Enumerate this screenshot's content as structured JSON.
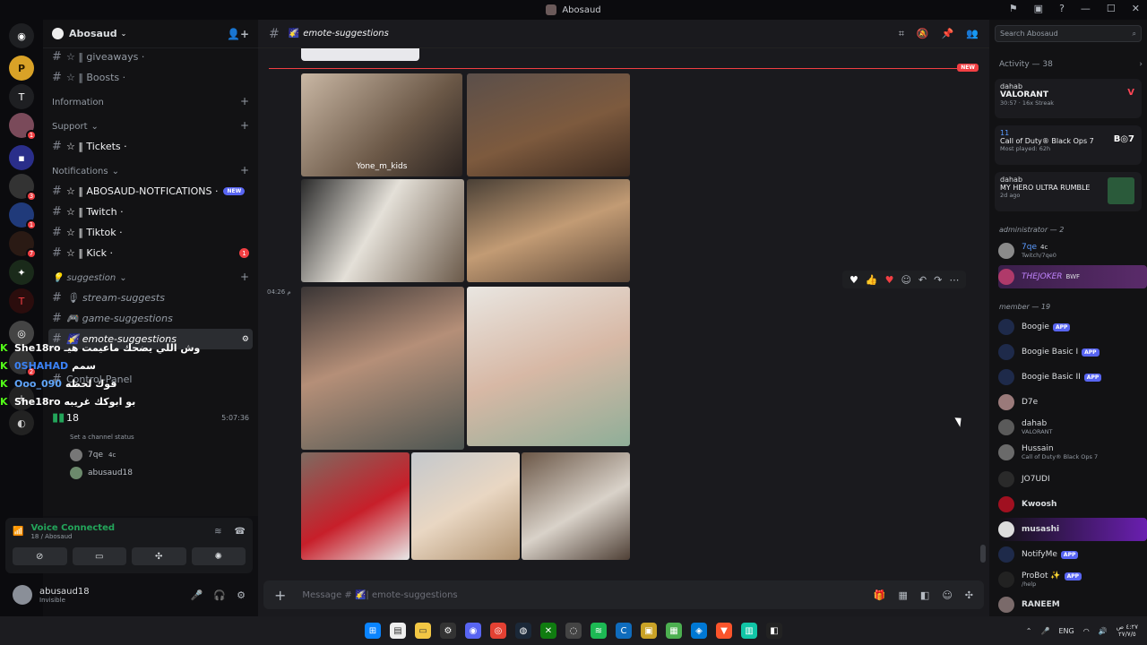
{
  "window": {
    "title": "Abosaud"
  },
  "guild": {
    "name": "Abosaud"
  },
  "channels": [
    {
      "label": "☆ ‖ giveaways ·",
      "y": 0
    },
    {
      "label": "☆ ‖ Boosts ·"
    }
  ],
  "categories": {
    "information": "Information",
    "support": "Support",
    "notifications": "Notifications",
    "suggestion": "suggestion"
  },
  "ch": {
    "giveaways": "☆ ‖ giveaways ·",
    "boosts": "☆ ‖ Boosts ·",
    "tickets": "☆ ‖ Tickets ·",
    "abosaud_notif": "☆ ‖ ABOSAUD-NOTFICATIONS ·",
    "new": "NEW",
    "twitch": "☆ ‖ Twitch ·",
    "tiktok": "☆ ‖ Tiktok ·",
    "kick": "☆ ‖ Kick ·",
    "kick_mentions": "1",
    "stream": "stream-suggests",
    "game": "game-suggestions",
    "emote": "emote-suggestions",
    "control": "Control-Panel",
    "voice": "18",
    "voice_time": "5:07:36",
    "voice_status": "Set a channel status",
    "voice_user1": "7qe",
    "voice_user1_tag": "4c",
    "voice_user2": "abusaud18"
  },
  "chat_overlay": [
    {
      "name": "She18ro",
      "text": "وش اللي يضحك ماعيمت هيـ"
    },
    {
      "name": "0SHAHAD",
      "text": "سمم"
    },
    {
      "name": "Ooo_090",
      "text": "فوك لحظه"
    },
    {
      "name": "She18ro",
      "text": "بو ابوكك غريبه"
    }
  ],
  "voice_panel": {
    "status": "Voice Connected",
    "channel": "18 / Abosaud"
  },
  "user": {
    "name": "abusaud18",
    "status": "Invisible"
  },
  "main": {
    "channel": "emote-suggestions",
    "new_label": "NEW",
    "timestamp": "04:26 م",
    "watermark": "Yone_m_kids",
    "composer_placeholder": "Message # 🌠| emote-suggestions"
  },
  "members_panel": {
    "search_placeholder": "Search Abosaud",
    "activity_header": "Activity — 38",
    "activities": [
      {
        "user": "dahab",
        "game": "VALORANT",
        "meta": "30:57 · 16x Streak"
      },
      {
        "user": "11",
        "game": "Call of Duty® Black Ops 7",
        "meta": "Most played: 62h"
      },
      {
        "user": "dahab",
        "game": "MY HERO ULTRA RUMBLE",
        "meta": "2d ago"
      }
    ],
    "admin_header": "administrator — 2",
    "admins": [
      {
        "name": "7qe",
        "tag": "4c",
        "sub": "Twitch/7qe0"
      },
      {
        "name": "THEJOKER",
        "tag": "BWF",
        "sub": ""
      }
    ],
    "member_header": "member — 19",
    "members": [
      {
        "name": "Boogie",
        "app": "APP",
        "sub": ""
      },
      {
        "name": "Boogie Basic I",
        "app": "APP",
        "sub": ""
      },
      {
        "name": "Boogie Basic II",
        "app": "APP",
        "sub": ""
      },
      {
        "name": "D7e",
        "app": "",
        "sub": ""
      },
      {
        "name": "dahab",
        "app": "",
        "sub": "VALORANT"
      },
      {
        "name": "Hussain",
        "app": "",
        "sub": "Call of Duty® Black Ops 7"
      },
      {
        "name": "JO7UDI",
        "app": "",
        "sub": ""
      },
      {
        "name": "Kwoosh",
        "app": "",
        "sub": ""
      },
      {
        "name": "musashi",
        "app": "",
        "sub": ""
      },
      {
        "name": "NotifyMe",
        "app": "APP",
        "sub": ""
      },
      {
        "name": "ProBot ✨",
        "app": "APP",
        "sub": "/help"
      },
      {
        "name": "RANEEM",
        "app": "",
        "sub": ""
      }
    ]
  },
  "taskbar": {
    "lang": "ENG",
    "time": "٤:٢٧ ص",
    "date": "٢٧/٧/٥"
  },
  "colors": {
    "accent": "#5865f2",
    "danger": "#f23f43",
    "online": "#23a55a"
  }
}
